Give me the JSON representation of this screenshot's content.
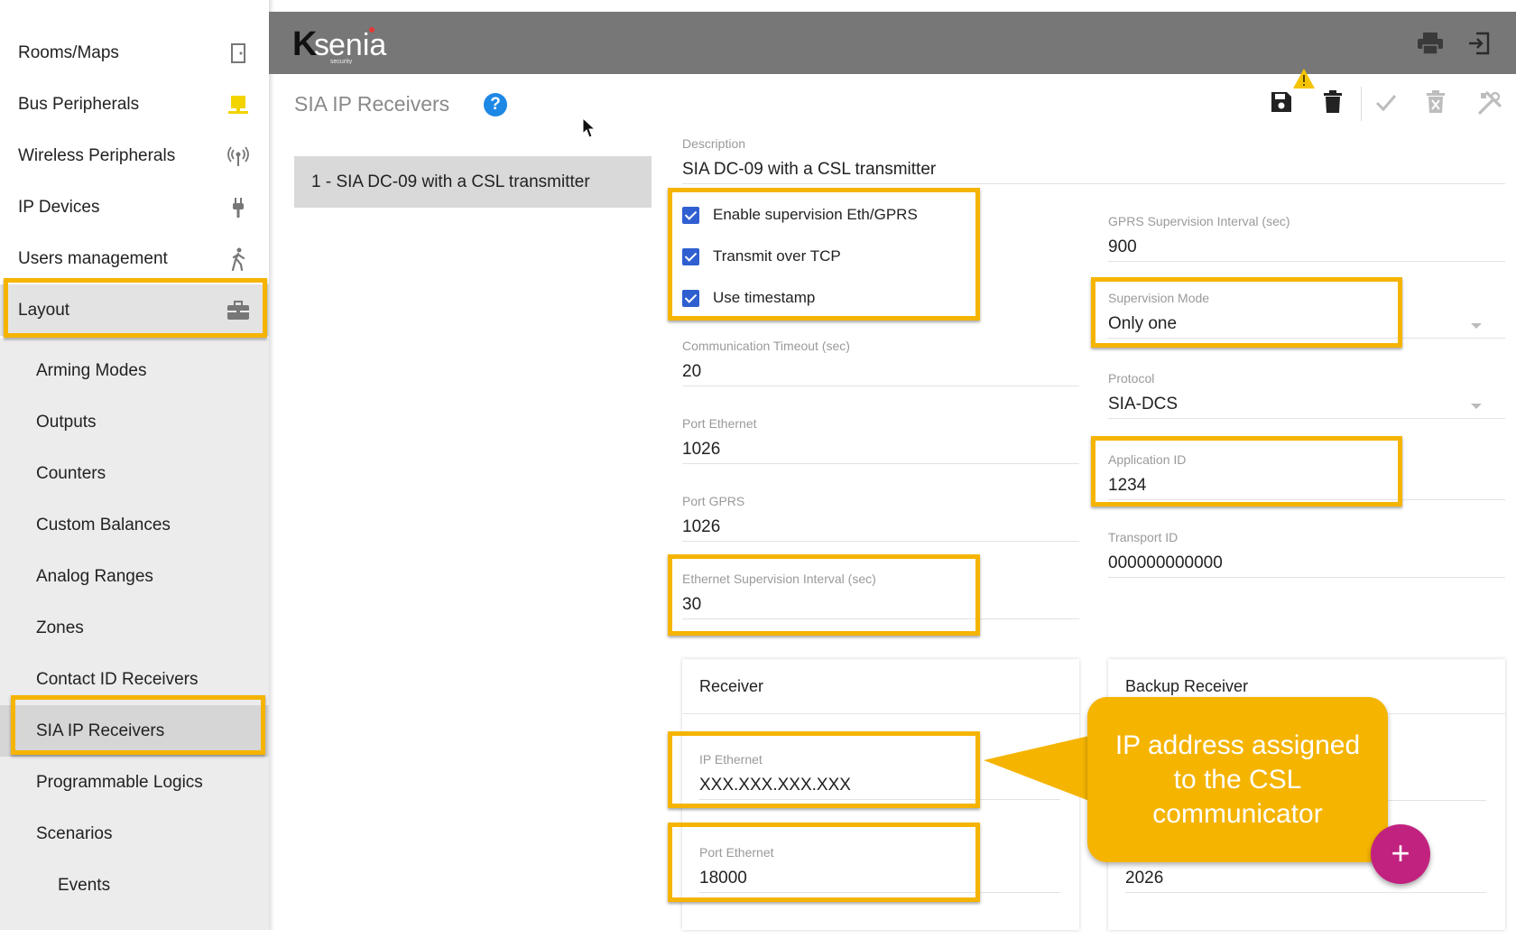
{
  "app": {
    "brand": "Ksenia",
    "brand_sub": "security"
  },
  "sidebar": {
    "items": [
      {
        "label": "Rooms/Maps",
        "icon": "door-icon"
      },
      {
        "label": "Bus Peripherals",
        "icon": "bus-peripheral-icon",
        "icon_color": "#f2d400"
      },
      {
        "label": "Wireless Peripherals",
        "icon": "wireless-icon"
      },
      {
        "label": "IP Devices",
        "icon": "plug-icon"
      },
      {
        "label": "Users management",
        "icon": "walking-person-icon"
      },
      {
        "label": "Layout",
        "icon": "briefcase-icon"
      }
    ],
    "sub_items": [
      "Arming Modes",
      "Outputs",
      "Counters",
      "Custom Balances",
      "Analog Ranges",
      "Zones",
      "Contact ID Receivers",
      "SIA IP Receivers",
      "Programmable Logics",
      "Scenarios",
      "Events"
    ]
  },
  "content": {
    "title": "SIA IP Receivers",
    "list": [
      "1 - SIA DC-09 with a CSL transmitter"
    ],
    "description": {
      "label": "Description",
      "value": "SIA DC-09 with a CSL transmitter"
    },
    "checkboxes": [
      {
        "label": "Enable supervision Eth/GPRS",
        "checked": true
      },
      {
        "label": "Transmit over TCP",
        "checked": true
      },
      {
        "label": "Use timestamp",
        "checked": true
      }
    ],
    "comm_timeout": {
      "label": "Communication Timeout (sec)",
      "value": "20"
    },
    "port_ethernet": {
      "label": "Port Ethernet",
      "value": "1026"
    },
    "port_gprs": {
      "label": "Port GPRS",
      "value": "1026"
    },
    "eth_supervision": {
      "label": "Ethernet Supervision Interval (sec)",
      "value": "30"
    },
    "gprs_supervision": {
      "label": "GPRS Supervision Interval (sec)",
      "value": "900"
    },
    "supervision_mode": {
      "label": "Supervision Mode",
      "value": "Only one"
    },
    "protocol": {
      "label": "Protocol",
      "value": "SIA-DCS"
    },
    "application_id": {
      "label": "Application ID",
      "value": "1234"
    },
    "transport_id": {
      "label": "Transport ID",
      "value": "000000000000"
    },
    "receiver": {
      "title": "Receiver",
      "ip_ethernet": {
        "label": "IP Ethernet",
        "value": "XXX.XXX.XXX.XXX"
      },
      "port_ethernet": {
        "label": "Port Ethernet",
        "value": "18000"
      }
    },
    "backup_receiver": {
      "title": "Backup Receiver",
      "port_value": "2026"
    },
    "callout": "IP address assigned to the CSL communicator"
  },
  "colors": {
    "highlight": "#f5b400",
    "topbar": "#777777",
    "fab": "#c2227f",
    "checkbox": "#2f5fd0",
    "help": "#1e88e5"
  }
}
